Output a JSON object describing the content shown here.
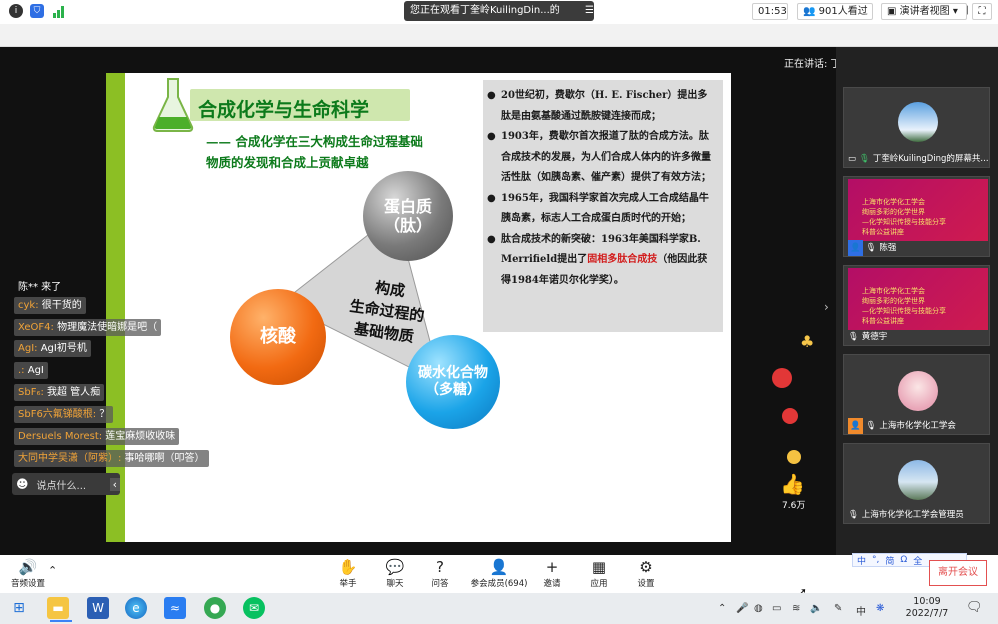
{
  "titlebar": {
    "sharing_text": "您正在观看丁奎岭KuilingDin...的屏幕",
    "menu_icon": "menu-icon",
    "minimize": "—",
    "restore": "❐",
    "close": "✕"
  },
  "toolbar": {
    "icons": [
      "info-icon",
      "shield-icon",
      "signal-icon"
    ],
    "timer": "01:53",
    "viewers": "901人看过",
    "view_mode": "演讲者视图",
    "view_mode_caret": "▾"
  },
  "speaking": "正在讲话: 丁奎岭KuilingDing;",
  "slide": {
    "title": "合成化学与生命科学",
    "subtitle_line1": "—— 合成化学在三大构成生命过程基础",
    "subtitle_line2": "物质的发现和合成上贡献卓越",
    "bullets": [
      {
        "parts": [
          {
            "text": "20世纪初，费歇尔（H. E. Fischer）提出多肽是由氨基酸通过酰胺键连接而成；",
            "red": false
          }
        ]
      },
      {
        "parts": [
          {
            "text": "1903年，费歇尔首次报道了肽的合成方法。肽合成技术的发展，为人们合成人体内的许多微量活性肽（如胰岛素、催产素）提供了有效方法；",
            "red": false
          }
        ]
      },
      {
        "parts": [
          {
            "text": "1965年，我国科学家首次完成人工合成结晶牛胰岛素，标志人工合成蛋白质时代的开始；",
            "red": false
          }
        ]
      },
      {
        "parts": [
          {
            "text": "肽合成技术的新突破：1963年美国科学家B. Merrifield提出了",
            "red": false
          },
          {
            "text": "固相多肽合成技",
            "red": true
          },
          {
            "text": "（他因此获得1984年诺贝尔化学奖）。",
            "red": false
          }
        ]
      }
    ],
    "ball_protein_l1": "蛋白质",
    "ball_protein_l2": "（肽）",
    "ball_nucleic": "核酸",
    "ball_carb_l1": "碳水化合物",
    "ball_carb_l2": "（多糖）",
    "center_l1": "构成",
    "center_l2": "生命过程的",
    "center_l3": "基础物质"
  },
  "chat": {
    "header": "陈** 来了",
    "messages": [
      {
        "name": "cyk:",
        "text": " 很干货的"
      },
      {
        "name": "XeOF4:",
        "text": " 物理魔法使暗娜是吧（"
      },
      {
        "name": "AgI:",
        "text": " AgI初号机"
      },
      {
        "name": ".:",
        "text": " AgI"
      },
      {
        "name": "SbF₆:",
        "text": " 我超 管人痴"
      },
      {
        "name": "SbF6六氟锑酸根:",
        "text": " ？"
      },
      {
        "name": "Dersuels Morest:",
        "text": " 莲宝麻烦收收味"
      },
      {
        "name": "大同中学吴潇（阿紫）:",
        "text": " 事哈哪啊（叩答）"
      }
    ],
    "input_placeholder": "说点什么...",
    "collapse": "‹"
  },
  "likes": {
    "count": "7.6万"
  },
  "participants": [
    {
      "label": "丁奎岭KuilingDing的屏幕共..."
    },
    {
      "label": "陈强",
      "ppt_l1": "上海市化学化工学会",
      "ppt_l2": "绚丽多彩的化学世界",
      "ppt_l3": "—化学知识传授与技能分享",
      "ppt_l4": "科普公益讲座"
    },
    {
      "label": "黄德宇",
      "ppt_l1": "上海市化学化工学会",
      "ppt_l2": "绚丽多彩的化学世界",
      "ppt_l3": "—化学知识传授与技能分享",
      "ppt_l4": "科普公益讲座"
    },
    {
      "label": "上海市化学化工学会"
    },
    {
      "label": "上海市化学化工学会管理员"
    }
  ],
  "bottombar": {
    "audio": "音频设置",
    "buttons": [
      "举手",
      "聊天",
      "问答",
      "参会成员(694)",
      "邀请",
      "应用",
      "设置"
    ],
    "leave": "离开会议",
    "ime": [
      "中",
      "°,",
      "简",
      "Ω",
      "全"
    ]
  },
  "taskbar": {
    "apps": [
      "windows-start-icon",
      "file-explorer-icon",
      "word-icon",
      "edge-icon",
      "tencent-meeting-icon",
      "browser-icon",
      "wechat-icon"
    ],
    "lang": "中",
    "time": "10:09",
    "date": "2022/7/7"
  }
}
